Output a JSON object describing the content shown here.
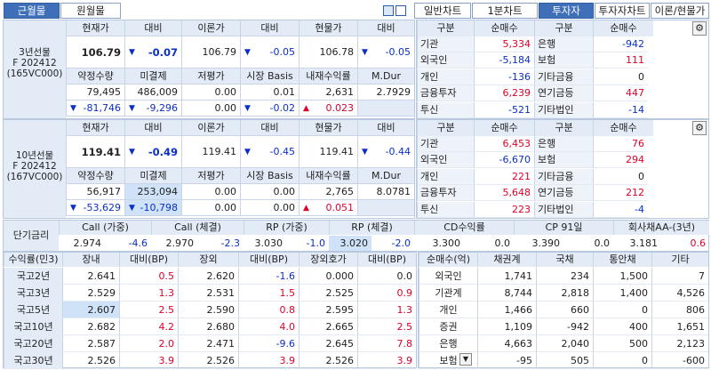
{
  "tabs": {
    "left": [
      {
        "label": "근월물"
      },
      {
        "label": "원월물"
      }
    ],
    "right": [
      {
        "label": "일반차트"
      },
      {
        "label": "1분차트"
      },
      {
        "label": "투자자"
      },
      {
        "label": "투자자차트"
      },
      {
        "label": "이론/현물가"
      }
    ]
  },
  "fut3": {
    "name": "3년선물",
    "code": "F 202412",
    "vc": "(165VC000)",
    "h1": [
      "현재가",
      "대비",
      "이론가",
      "대비",
      "현물가",
      "대비"
    ],
    "v1": [
      "106.79",
      "-0.07",
      "106.79",
      "-0.05",
      "106.78",
      "-0.05"
    ],
    "h2": [
      "약정수량",
      "미결제",
      "저평가",
      "시장 Basis",
      "내재수익률",
      "M.Dur"
    ],
    "v2": [
      "79,495",
      "486,009",
      "0.00",
      "0.01",
      "2,631",
      "2.7929"
    ],
    "v3": [
      "-81,746",
      "-9,296",
      "0.00",
      "-0.02",
      "0.023",
      ""
    ]
  },
  "fut10": {
    "name": "10년선물",
    "code": "F 202412",
    "vc": "(167VC000)",
    "h1": [
      "현재가",
      "대비",
      "이론가",
      "대비",
      "현물가",
      "대비"
    ],
    "v1": [
      "119.41",
      "-0.49",
      "119.41",
      "-0.45",
      "119.41",
      "-0.44"
    ],
    "h2": [
      "약정수량",
      "미결제",
      "저평가",
      "시장 Basis",
      "내재수익률",
      "M.Dur"
    ],
    "v2": [
      "56,917",
      "253,094",
      "0.00",
      "0.00",
      "2,765",
      "8.0781"
    ],
    "v3": [
      "-53,629",
      "-10,798",
      "0.00",
      "0.00",
      "0.051",
      ""
    ]
  },
  "inv1": {
    "head": [
      "구분",
      "순매수",
      "구분",
      "순매수"
    ],
    "rows": [
      [
        "기관",
        "5,334",
        "은행",
        "-942"
      ],
      [
        "외국인",
        "-5,184",
        "보험",
        "111"
      ],
      [
        "개인",
        "-136",
        "기타금융",
        "0"
      ],
      [
        "금융투자",
        "6,239",
        "연기금등",
        "447"
      ],
      [
        "투신",
        "-521",
        "기타법인",
        "-14"
      ]
    ]
  },
  "inv2": {
    "head": [
      "구분",
      "순매수",
      "구분",
      "순매수"
    ],
    "rows": [
      [
        "기관",
        "6,453",
        "은행",
        "76"
      ],
      [
        "외국인",
        "-6,670",
        "보험",
        "294"
      ],
      [
        "개인",
        "221",
        "기타금융",
        "0"
      ],
      [
        "금융투자",
        "5,648",
        "연기금등",
        "212"
      ],
      [
        "투신",
        "223",
        "기타법인",
        "-4"
      ]
    ]
  },
  "short": {
    "label": "단기금리",
    "heads": [
      "Call (가중)",
      "Call (체결)",
      "RP (가중)",
      "RP (체결)",
      "CD수익률",
      "CP 91일",
      "회사채AA-(3년)"
    ],
    "vals": [
      [
        "2.974",
        "-4.6"
      ],
      [
        "2.970",
        "-2.3"
      ],
      [
        "3.030",
        "-1.0"
      ],
      [
        "3.020",
        "-2.0"
      ],
      [
        "3.300",
        "0.0"
      ],
      [
        "3.390",
        "0.0"
      ],
      [
        "3.181",
        "0.6"
      ]
    ]
  },
  "yld": {
    "head": [
      "수익률(민3)",
      "장내",
      "대비(BP)",
      "장외",
      "대비(BP)",
      "장외호가",
      "대비(BP)"
    ],
    "rows": [
      [
        "국고2년",
        "2.641",
        "0.5",
        "2.620",
        "-1.6",
        "0.000",
        "0.0"
      ],
      [
        "국고3년",
        "2.529",
        "1.3",
        "2.531",
        "1.5",
        "2.525",
        "0.9"
      ],
      [
        "국고5년",
        "2.607",
        "2.5",
        "2.590",
        "0.8",
        "2.595",
        "1.3"
      ],
      [
        "국고10년",
        "2.682",
        "4.2",
        "2.680",
        "4.0",
        "2.665",
        "2.5"
      ],
      [
        "국고20년",
        "2.587",
        "2.0",
        "2.471",
        "-9.6",
        "2.645",
        "7.8"
      ],
      [
        "국고30년",
        "2.526",
        "3.9",
        "2.526",
        "3.9",
        "2.526",
        "3.9"
      ]
    ]
  },
  "net": {
    "head": [
      "순매수(억)",
      "채권계",
      "국채",
      "통안채",
      "기타"
    ],
    "rows": [
      [
        "외국인",
        "1,741",
        "234",
        "1,500",
        "7"
      ],
      [
        "기관계",
        "8,744",
        "2,818",
        "1,400",
        "4,526"
      ],
      [
        "개인",
        "1,466",
        "660",
        "0",
        "806"
      ],
      [
        "증권",
        "1,109",
        "-942",
        "400",
        "1,651"
      ],
      [
        "은행",
        "4,663",
        "2,040",
        "500",
        "2,123"
      ],
      [
        "보험",
        "-95",
        "505",
        "0",
        "-600"
      ]
    ]
  },
  "icons": {
    "gear": "⚙",
    "dropdown": "▼"
  }
}
